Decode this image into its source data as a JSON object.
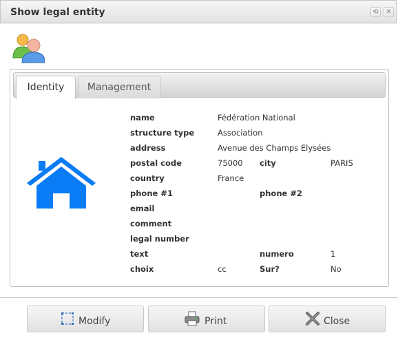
{
  "window": {
    "title": "Show legal entity",
    "controls": {
      "restore_icon": "restore-icon",
      "close_icon": "close-icon",
      "restore_glyph": "⟲",
      "close_glyph": "✕"
    }
  },
  "header_icon": "users-icon",
  "tabs": [
    {
      "label": "Identity",
      "active": true
    },
    {
      "label": "Management",
      "active": false
    }
  ],
  "entity_icon": "house-icon",
  "fields": {
    "name": {
      "label": "name",
      "value": "Fédération National"
    },
    "structure_type": {
      "label": "structure type",
      "value": "Association"
    },
    "address": {
      "label": "address",
      "value": "Avenue des Champs Elysées"
    },
    "postal_code": {
      "label": "postal code",
      "value": "75000"
    },
    "city": {
      "label": "city",
      "value": "PARIS"
    },
    "country": {
      "label": "country",
      "value": "France"
    },
    "phone1": {
      "label": "phone #1",
      "value": ""
    },
    "phone2": {
      "label": "phone #2",
      "value": ""
    },
    "email": {
      "label": "email",
      "value": ""
    },
    "comment": {
      "label": "comment",
      "value": ""
    },
    "legal_number": {
      "label": "legal number",
      "value": ""
    },
    "text": {
      "label": "text",
      "value": ""
    },
    "numero": {
      "label": "numero",
      "value": "1"
    },
    "choix": {
      "label": "choix",
      "value": "cc"
    },
    "sur": {
      "label": "Sur?",
      "value": "No"
    }
  },
  "buttons": {
    "modify": {
      "label": "Modify",
      "icon": "modify-icon"
    },
    "print": {
      "label": "Print",
      "icon": "printer-icon"
    },
    "close": {
      "label": "Close",
      "icon": "close-x-icon"
    }
  },
  "colors": {
    "house": "#0a7cf5"
  }
}
